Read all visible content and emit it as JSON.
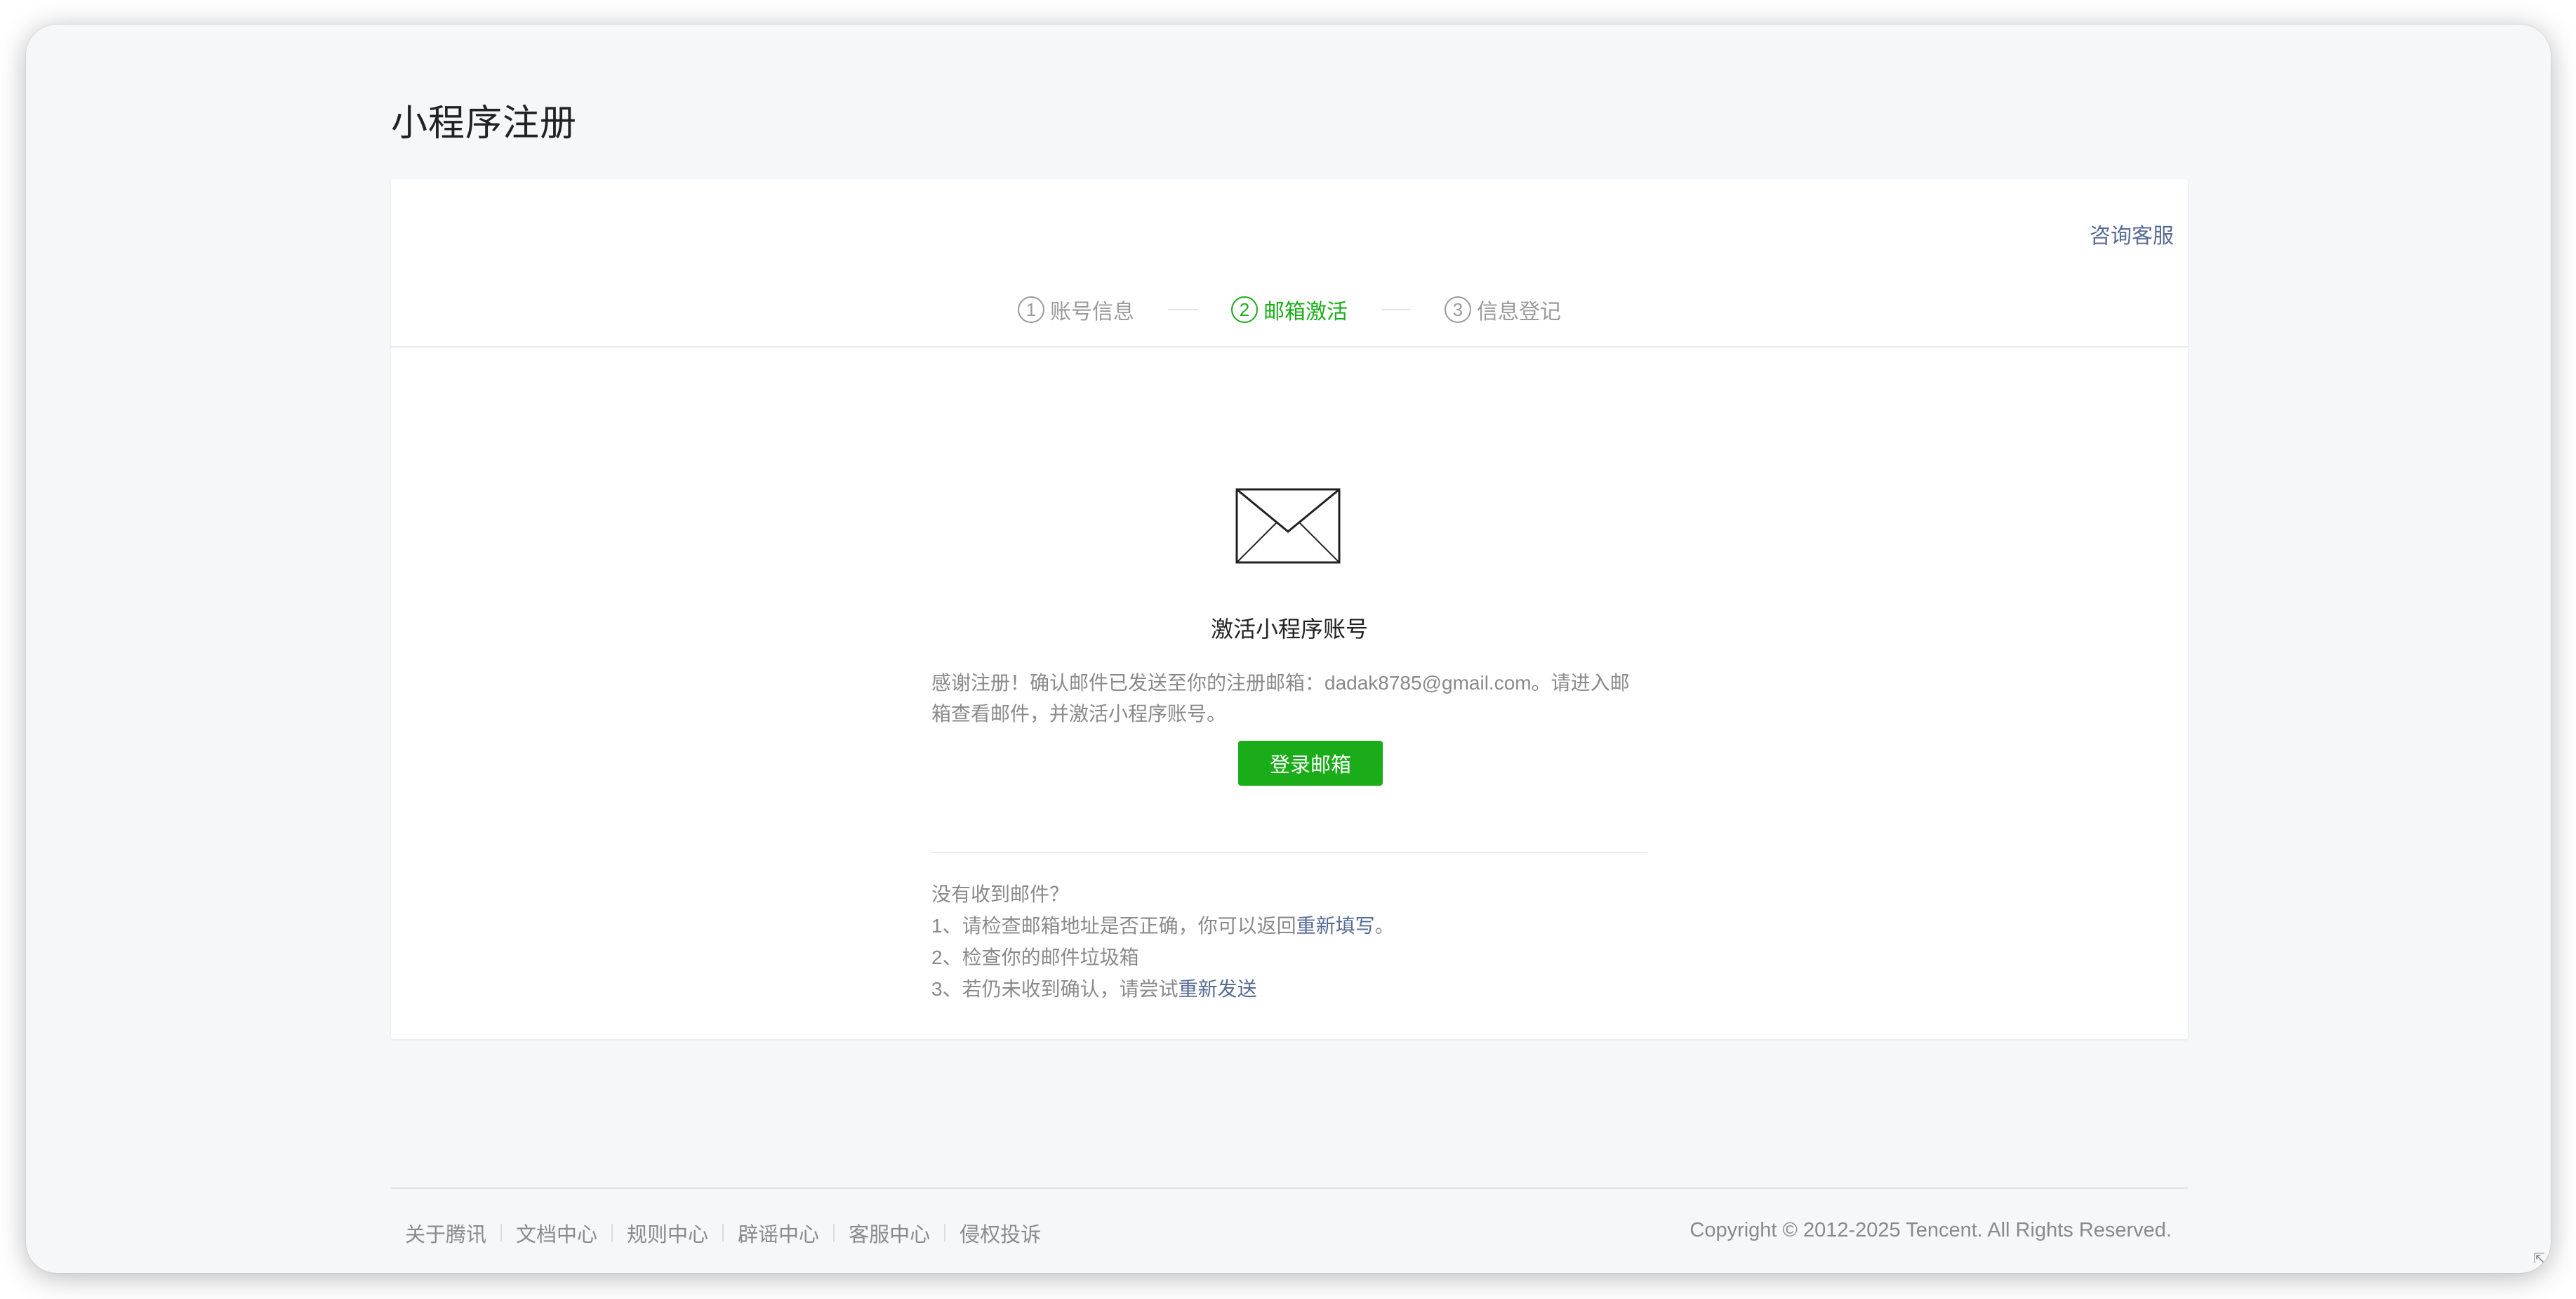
{
  "page": {
    "title": "小程序注册"
  },
  "header": {
    "consult_label": "咨询客服"
  },
  "steps": [
    {
      "num": "1",
      "label": "账号信息"
    },
    {
      "num": "2",
      "label": "邮箱激活"
    },
    {
      "num": "3",
      "label": "信息登记"
    }
  ],
  "activate": {
    "icon": "envelope-icon",
    "title": "激活小程序账号",
    "description": "感谢注册！确认邮件已发送至你的注册邮箱：dadak8785@gmail.com。请进入邮箱查看邮件，并激活小程序账号。",
    "login_button": "登录邮箱"
  },
  "help": {
    "heading": "没有收到邮件？",
    "item1_prefix": "1、请检查邮箱地址是否正确，你可以返回",
    "item1_link": "重新填写",
    "item1_suffix": "。",
    "item2": "2、检查你的邮件垃圾箱",
    "item3_prefix": "3、若仍未收到确认，请尝试",
    "item3_link": "重新发送"
  },
  "footer": {
    "links": [
      "关于腾讯",
      "文档中心",
      "规则中心",
      "辟谣中心",
      "客服中心",
      "侵权投诉"
    ],
    "copyright": "Copyright © 2012-2025 Tencent. All Rights Reserved."
  },
  "colors": {
    "accent_green": "#1aad19",
    "link_blue": "#576b95",
    "background": "#f6f7f9"
  }
}
